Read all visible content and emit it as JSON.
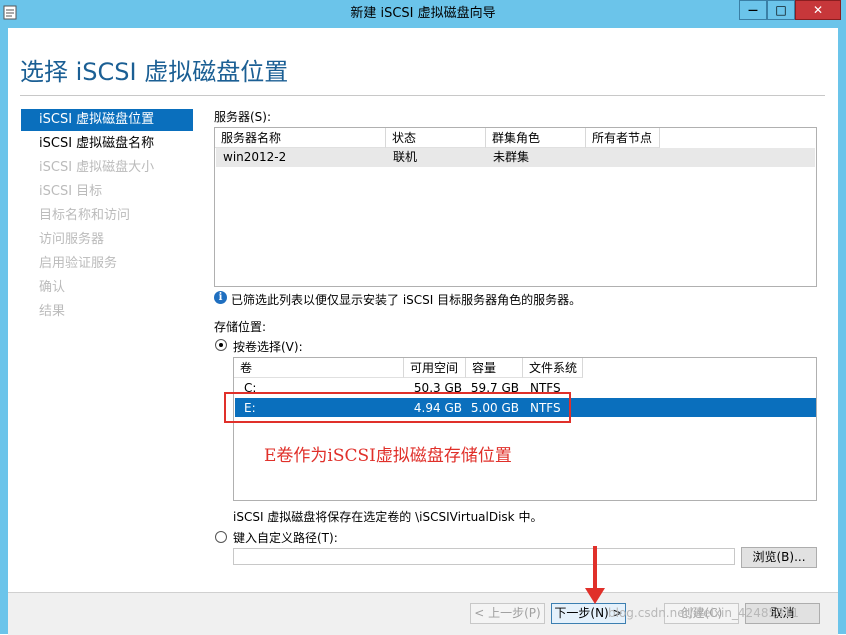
{
  "window": {
    "title": "新建 iSCSI 虚拟磁盘向导",
    "minimize_glyph": "—",
    "maximize_glyph": "□",
    "close_glyph": "✕"
  },
  "page_heading": "选择 iSCSI 虚拟磁盘位置",
  "nav": [
    {
      "label": "iSCSI 虚拟磁盘位置",
      "state": "selected"
    },
    {
      "label": "iSCSI 虚拟磁盘名称",
      "state": "enabled"
    },
    {
      "label": "iSCSI 虚拟磁盘大小",
      "state": "disabled"
    },
    {
      "label": "iSCSI 目标",
      "state": "disabled"
    },
    {
      "label": "目标名称和访问",
      "state": "disabled"
    },
    {
      "label": "访问服务器",
      "state": "disabled"
    },
    {
      "label": "启用验证服务",
      "state": "disabled"
    },
    {
      "label": "确认",
      "state": "disabled"
    },
    {
      "label": "结果",
      "state": "disabled"
    }
  ],
  "servers": {
    "label": "服务器(S):",
    "columns": [
      "服务器名称",
      "状态",
      "群集角色",
      "所有者节点"
    ],
    "rows": [
      [
        "win2012-2",
        "联机",
        "未群集",
        ""
      ]
    ]
  },
  "info": {
    "icon": "info-icon",
    "glyph": "i",
    "text": "已筛选此列表以便仅显示安装了 iSCSI 目标服务器角色的服务器。"
  },
  "storage": {
    "label": "存储位置:",
    "by_volume_label": "按卷选择(V):",
    "by_volume_selected": true,
    "volume_columns": [
      "卷",
      "可用空间",
      "容量",
      "文件系统"
    ],
    "volumes": [
      {
        "name": "C:",
        "free": "50.3 GB",
        "capacity": "59.7 GB",
        "fs": "NTFS",
        "selected": false
      },
      {
        "name": "E:",
        "free": "4.94 GB",
        "capacity": "5.00 GB",
        "fs": "NTFS",
        "selected": true
      }
    ],
    "note": "iSCSI 虚拟磁盘将保存在选定卷的 \\iSCSIVirtualDisk 中。",
    "custom_path_label": "键入自定义路径(T):",
    "custom_path_value": "",
    "browse_label": "浏览(B)..."
  },
  "annotation": {
    "text": "E卷作为iSCSI虚拟磁盘存储位置",
    "color": "#e0302a"
  },
  "buttons": {
    "back": "< 上一步(P)",
    "next": "下一步(N) >",
    "create": "创建(C)",
    "cancel": "取消"
  },
  "watermark": "blog.csdn.net/weixin_42485311",
  "colors": {
    "titlebar": "#6bc4ea",
    "accent": "#0a6fbd",
    "heading": "#1b5f94",
    "close": "#c7373a"
  }
}
